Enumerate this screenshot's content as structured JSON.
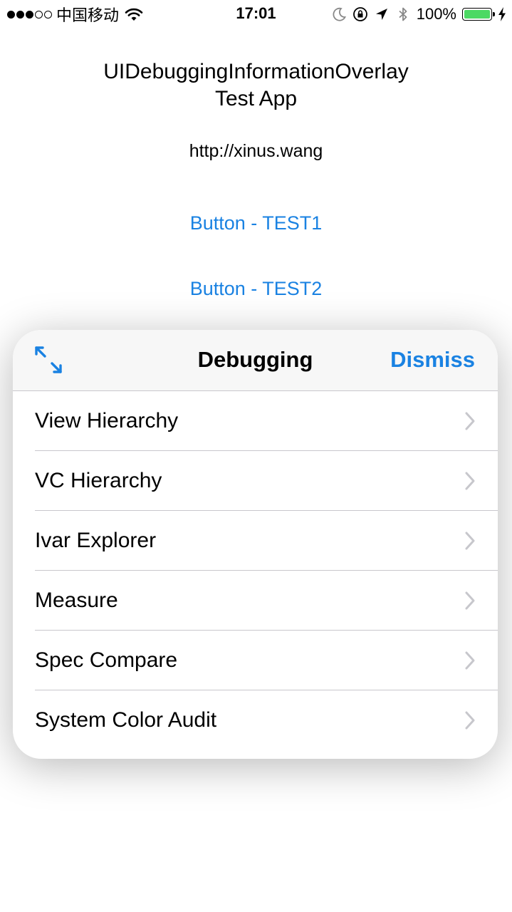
{
  "status_bar": {
    "carrier": "中国移动",
    "time": "17:01",
    "battery_percent": "100%",
    "signal_bars_filled": 3,
    "signal_bars_total": 5,
    "icons": [
      "signal-dots-icon",
      "wifi-icon",
      "moon-icon",
      "orientation-lock-icon",
      "location-arrow-icon",
      "bluetooth-icon",
      "battery-icon",
      "charging-bolt-icon"
    ],
    "battery_color": "#4cd964"
  },
  "app": {
    "title_line1": "UIDebuggingInformationOverlay",
    "title_line2": "Test App",
    "url": "http://xinus.wang",
    "button1_label": "Button - TEST1",
    "button2_label": "Button - TEST2",
    "accent_color": "#1a82e2"
  },
  "overlay": {
    "title": "Debugging",
    "dismiss_label": "Dismiss",
    "expand_icon": "expand-arrows-icon",
    "items": [
      {
        "label": "View Hierarchy"
      },
      {
        "label": "VC Hierarchy"
      },
      {
        "label": "Ivar Explorer"
      },
      {
        "label": "Measure"
      },
      {
        "label": "Spec Compare"
      },
      {
        "label": "System Color Audit"
      }
    ]
  }
}
